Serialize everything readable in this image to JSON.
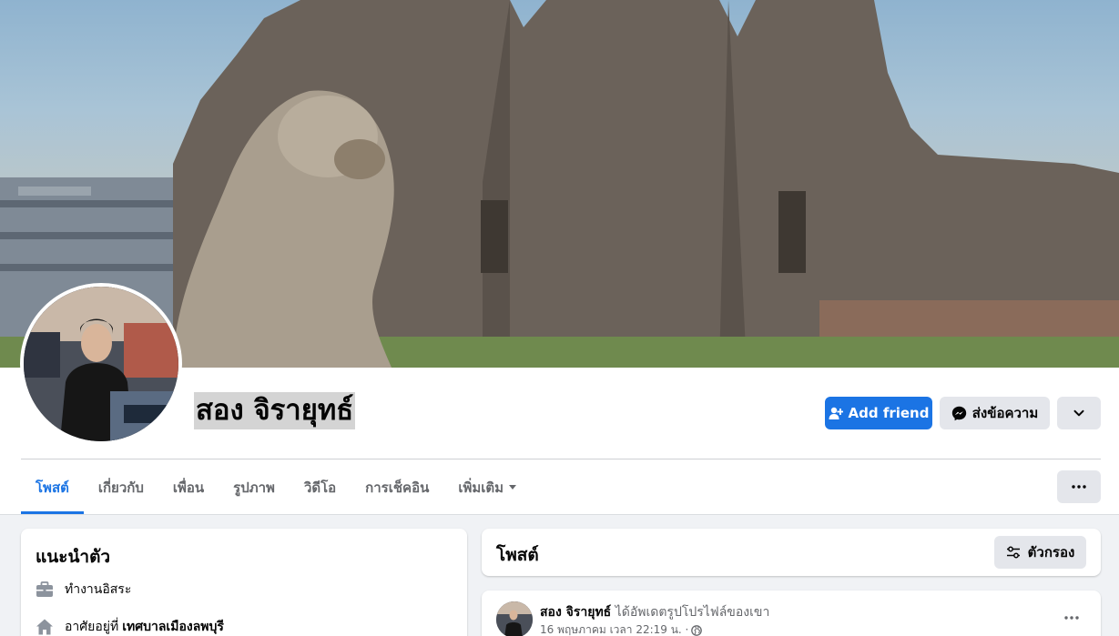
{
  "profile": {
    "name": "สอง จิรายุทธ์"
  },
  "actions": {
    "add_friend": "Add friend",
    "message": "ส่งข้อความ"
  },
  "tabs": [
    {
      "label": "โพสต์",
      "active": true
    },
    {
      "label": "เกี่ยวกับ"
    },
    {
      "label": "เพื่อน"
    },
    {
      "label": "รูปภาพ"
    },
    {
      "label": "วิดีโอ"
    },
    {
      "label": "การเช็คอิน"
    },
    {
      "label": "เพิ่มเติม"
    }
  ],
  "intro": {
    "title": "แนะนำตัว",
    "work": "ทำงานอิสระ",
    "lives_prefix": "อาศัยอยู่ที่",
    "lives_place": "เทศบาลเมืองลพบุรี"
  },
  "posts": {
    "title": "โพสต์",
    "filter_label": "ตัวกรอง",
    "first": {
      "author": "สอง จิรายุทธ์",
      "action": "ได้อัพเดตรูปโปรไฟล์ของเขา",
      "time": "16 พฤษภาคม เวลา 22:19 น. ·",
      "privacy_icon": "globe-icon"
    }
  },
  "colors": {
    "accent": "#1b74e4",
    "secondary_button": "#e4e6eb",
    "background": "#f0f2f5",
    "muted_text": "#65676b"
  }
}
